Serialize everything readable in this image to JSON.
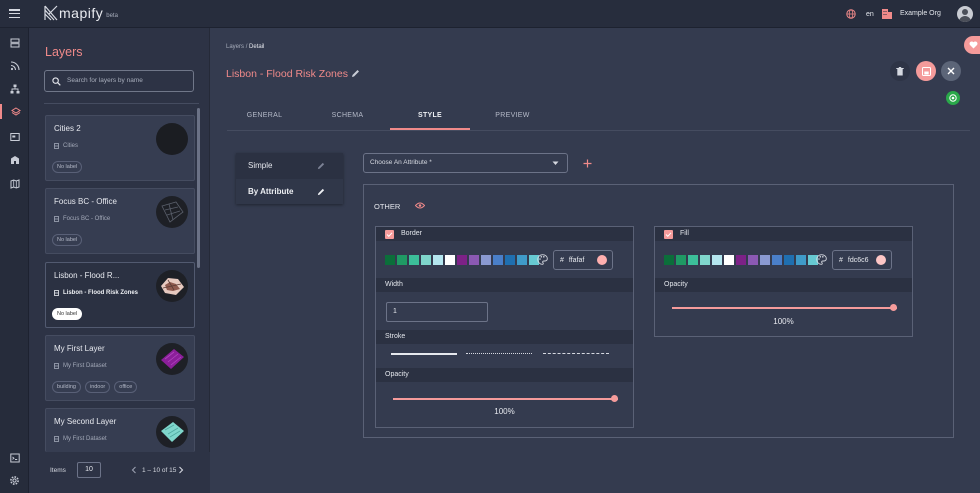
{
  "app": {
    "name": "mapify",
    "badge": "beta"
  },
  "topbar": {
    "language": "en",
    "org": "Example Org"
  },
  "panel": {
    "title": "Layers",
    "search_placeholder": "Search for layers by name",
    "layers": [
      {
        "name": "Cities 2",
        "dataset": "Cities",
        "tags": [
          "No label"
        ]
      },
      {
        "name": "Focus BC - Office",
        "dataset": "Focus BC - Office",
        "tags": [
          "No label"
        ]
      },
      {
        "name": "Lisbon - Flood R...",
        "dataset": "Lisbon - Flood Risk Zones",
        "tags": [
          "No label"
        ]
      },
      {
        "name": "My First Layer",
        "dataset": "My First Dataset",
        "tags": [
          "building",
          "indoor",
          "office"
        ]
      },
      {
        "name": "My Second Layer",
        "dataset": "My First Dataset",
        "tags": []
      }
    ],
    "pager": {
      "items_label": "Items",
      "page_size": "10",
      "range": "1 – 10 of 15"
    }
  },
  "detail": {
    "breadcrumb_root": "Layers",
    "breadcrumb_sep": "/",
    "breadcrumb_current": "Detail",
    "title": "Lisbon - Flood Risk Zones",
    "tabs": [
      "GENERAL",
      "SCHEMA",
      "STYLE",
      "PREVIEW"
    ],
    "active_tab": "STYLE"
  },
  "style": {
    "modes": [
      "Simple",
      "By Attribute"
    ],
    "attribute_select": "Choose An Attribute *",
    "group_label": "OTHER",
    "border": {
      "label": "Border",
      "hex": "ffafaf",
      "color": "#ffafaf",
      "width_label": "Width",
      "width_value": "1",
      "stroke_label": "Stroke",
      "opacity_label": "Opacity",
      "opacity_value": "100%",
      "opacity": 1.0
    },
    "fill": {
      "label": "Fill",
      "hex": "fdc6c6",
      "color": "#fdc6c6",
      "opacity_label": "Opacity",
      "opacity_value": "100%",
      "opacity": 1.0
    },
    "swatch_colors": [
      "#0b6e3a",
      "#1f9a64",
      "#3cbf9a",
      "#7fd6cc",
      "#b4e6ef",
      "#ffffff",
      "#7d2187",
      "#8b59b3",
      "#8a99d1",
      "#4a7fc9",
      "#1f6fb0",
      "#3f9bc9",
      "#66c9d2"
    ],
    "accent": "#f59b9b"
  }
}
